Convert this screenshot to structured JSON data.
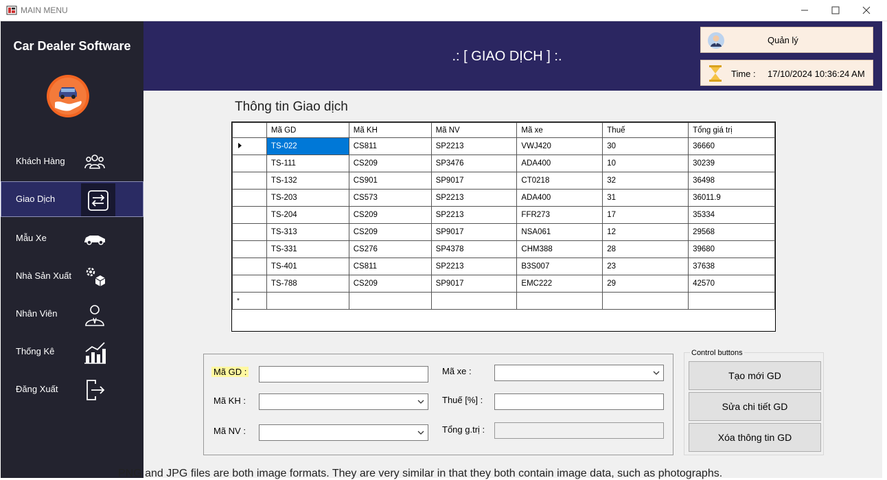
{
  "window": {
    "title": "MAIN MENU"
  },
  "sidebar": {
    "brand": "Car Dealer Software",
    "items": [
      {
        "label": "Khách Hàng",
        "icon": "customers-icon"
      },
      {
        "label": "Giao Dịch",
        "icon": "transaction-icon",
        "active": true
      },
      {
        "label": "Mẫu Xe",
        "icon": "car-icon"
      },
      {
        "label": "Nhà Sản Xuất",
        "icon": "manufacturer-icon"
      },
      {
        "label": "Nhân Viên",
        "icon": "employee-icon"
      },
      {
        "label": "Thống Kê",
        "icon": "statistics-icon"
      },
      {
        "label": "Đăng Xuất",
        "icon": "logout-icon"
      }
    ]
  },
  "header": {
    "title": ".: [ GIAO DỊCH ] :.",
    "user": "Quản lý",
    "time_label": "Time :",
    "time_value": "17/10/2024 10:36:24 AM"
  },
  "grid": {
    "title": "Thông tin Giao dịch",
    "columns": [
      "Mã GD",
      "Mã KH",
      "Mã NV",
      "Mã xe",
      "Thuế",
      "Tổng giá trị"
    ],
    "rows": [
      [
        "TS-022",
        "CS811",
        "SP2213",
        "VWJ420",
        "30",
        "36660"
      ],
      [
        "TS-111",
        "CS209",
        "SP3476",
        "ADA400",
        "10",
        "30239"
      ],
      [
        "TS-132",
        "CS901",
        "SP9017",
        "CT0218",
        "32",
        "36498"
      ],
      [
        "TS-203",
        "CS573",
        "SP2213",
        "ADA400",
        "31",
        "36011.9"
      ],
      [
        "TS-204",
        "CS209",
        "SP2213",
        "FFR273",
        "17",
        "35334"
      ],
      [
        "TS-313",
        "CS209",
        "SP9017",
        "NSA061",
        "12",
        "29568"
      ],
      [
        "TS-331",
        "CS276",
        "SP4378",
        "CHM388",
        "28",
        "39680"
      ],
      [
        "TS-401",
        "CS811",
        "SP2213",
        "B3S007",
        "23",
        "37638"
      ],
      [
        "TS-788",
        "CS209",
        "SP9017",
        "EMC222",
        "29",
        "42570"
      ]
    ],
    "new_row_marker": "*"
  },
  "form": {
    "ma_gd_label": "Mã GD :",
    "ma_kh_label": "Mã KH :",
    "ma_nv_label": "Mã NV :",
    "ma_xe_label": "Mã xe :",
    "thue_label": "Thuế [%] :",
    "tong_label": "Tổng g.trị :",
    "ma_gd_value": "",
    "ma_kh_value": "",
    "ma_nv_value": "",
    "ma_xe_value": "",
    "thue_value": "",
    "tong_value": ""
  },
  "controls": {
    "legend": "Control buttons",
    "create": "Tạo mới GD",
    "edit": "Sửa chi tiết GD",
    "delete": "Xóa thông tin GD"
  },
  "overflow_text": "PNG and JPG files are both image formats. They are very similar in that they both contain image data, such as photographs.",
  "colors": {
    "sidebar_bg": "#23232f",
    "header_bg": "#2b2661",
    "active_item_bg": "#2a2b63",
    "selection": "#0078d7",
    "logo_orange": "#f26522"
  }
}
